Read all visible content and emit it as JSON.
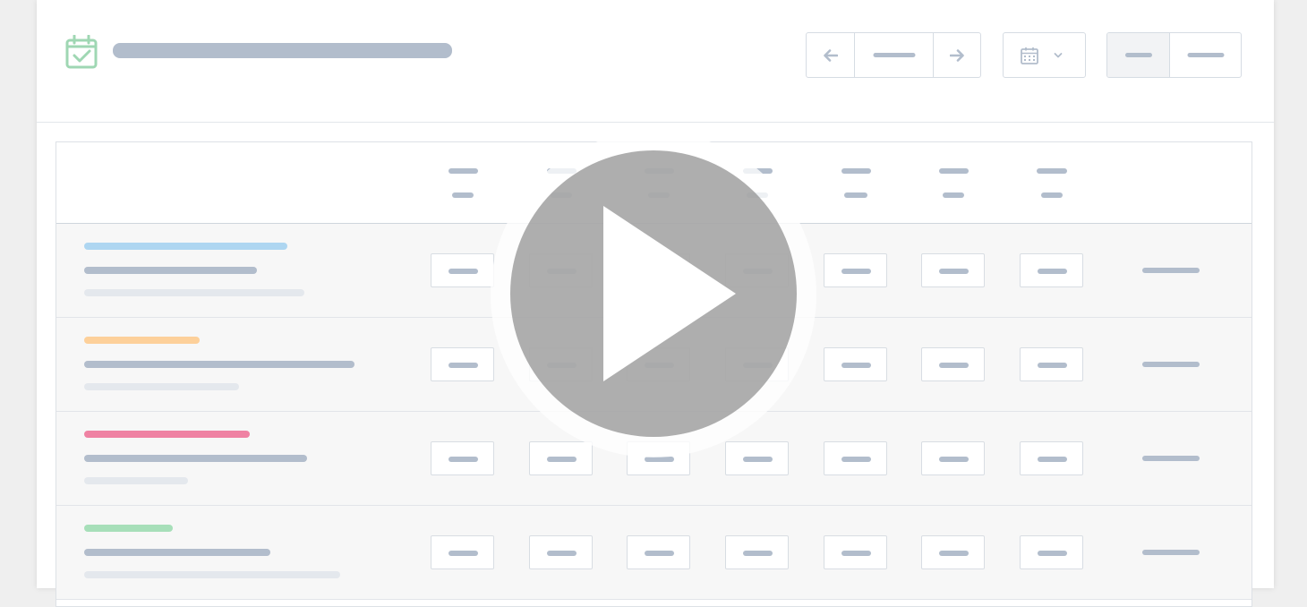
{
  "colors": {
    "page_background": "#efefef",
    "panel": "#ffffff",
    "row_background": "#f7f7f7",
    "placeholder_bar": "#b2bdcc",
    "placeholder_bar_light": "#e4e8ed",
    "border": "#d6dce3",
    "icon_green": "#9fd7b3",
    "active_segment": "#f2f3f5",
    "play_overlay": "#8c8c8c"
  },
  "header": {
    "title_icon": "calendar-check-icon",
    "nav_icons": [
      "arrow-left-icon",
      "arrow-right-icon"
    ],
    "date_picker_icons": [
      "calendar-icon",
      "chevron-down-icon"
    ]
  },
  "timesheet": {
    "day_columns": 7,
    "rows": [
      {
        "accent_color": "#aed6f1"
      },
      {
        "accent_color": "#fdd09a"
      },
      {
        "accent_color": "#ef82a3"
      },
      {
        "accent_color": "#a7dfb9"
      }
    ]
  },
  "overlay": {
    "icon": "play-icon"
  }
}
